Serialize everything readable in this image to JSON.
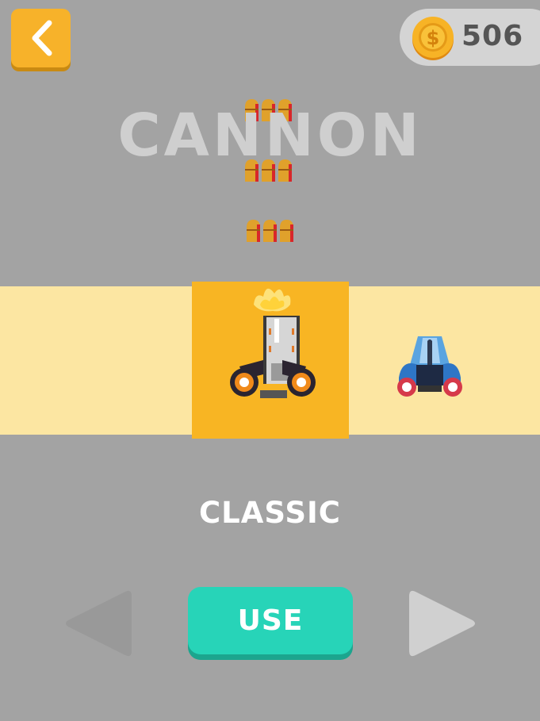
{
  "header": {
    "coins": "506"
  },
  "weapon": {
    "title": "CANNON"
  },
  "vehicle": {
    "name": "CLASSIC"
  },
  "actions": {
    "use_label": "USE"
  },
  "colors": {
    "background": "#a3a3a3",
    "accent": "#f8b523",
    "strip": "#fce6a2",
    "use_button": "#27d4b8"
  },
  "icons": [
    "back-arrow-icon",
    "coin-icon",
    "bullet-icon",
    "prev-arrow-icon",
    "next-arrow-icon"
  ]
}
